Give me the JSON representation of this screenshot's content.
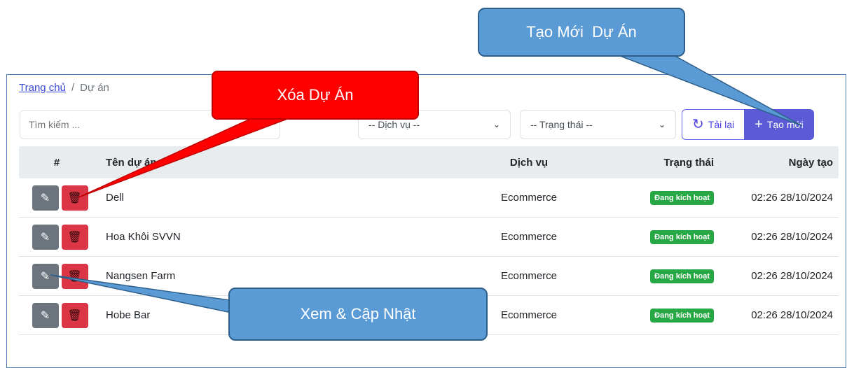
{
  "breadcrumb": {
    "home": "Trang chủ",
    "separator": "/",
    "current": "Dự án"
  },
  "filters": {
    "search_placeholder": "Tìm kiếm ...",
    "service_select": "-- Dịch vụ --",
    "status_select": "-- Trạng thái --"
  },
  "toolbar": {
    "reload_label": "Tải lại",
    "create_label": "Tạo mới",
    "reload_icon": "refresh-icon",
    "create_icon": "plus-icon"
  },
  "table": {
    "headers": {
      "index": "#",
      "name": "Tên dự án",
      "service": "Dịch vụ",
      "status": "Trạng thái",
      "created": "Ngày tạo"
    },
    "rows": [
      {
        "name": "Dell",
        "service": "Ecommerce",
        "status": "Đang kích hoạt",
        "created": "02:26 28/10/2024"
      },
      {
        "name": "Hoa Khôi SVVN",
        "service": "Ecommerce",
        "status": "Đang kích hoạt",
        "created": "02:26 28/10/2024"
      },
      {
        "name": "Nangsen Farm",
        "service": "Ecommerce",
        "status": "Đang kích hoạt",
        "created": "02:26 28/10/2024"
      },
      {
        "name": "Hobe Bar",
        "service": "Ecommerce",
        "status": "Đang kích hoạt",
        "created": "02:26 28/10/2024"
      }
    ]
  },
  "callouts": {
    "create": "Tạo Mới  Dự Án",
    "delete": "Xóa Dự Án",
    "edit": "Xem & Cập Nhật"
  },
  "colors": {
    "accent": "#5b5bd6",
    "success": "#28a745",
    "danger": "#dc3545",
    "secondary": "#6c757d",
    "callout_blue": "#5b9bd5",
    "callout_red": "#ff0000"
  }
}
